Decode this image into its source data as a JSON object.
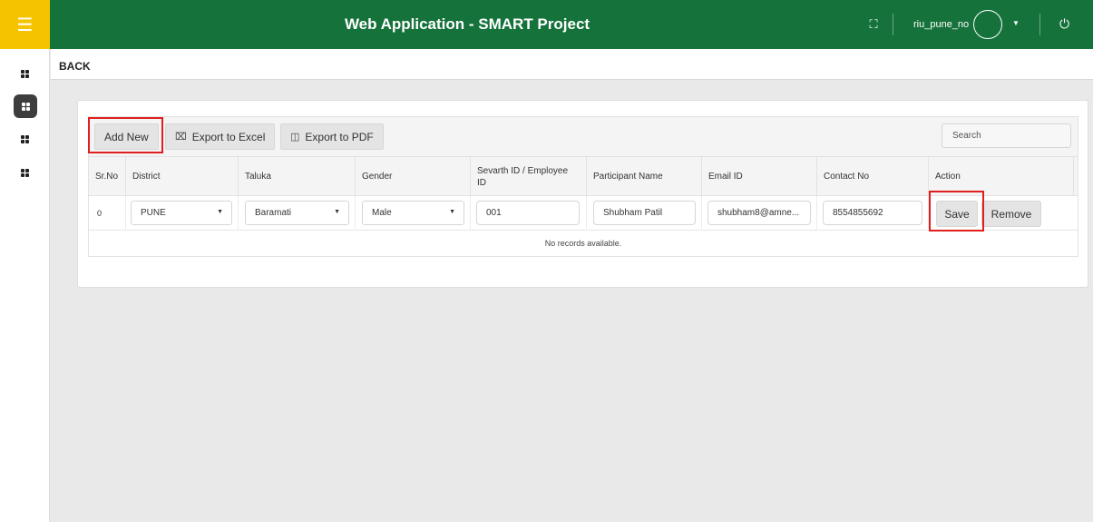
{
  "header": {
    "menu_icon": "hamburger-icon",
    "title": "Web Application - SMART Project",
    "fullscreen_icon": "fullscreen-icon",
    "username": "riu_pune_no",
    "power_icon": "power-icon"
  },
  "sidebar": {
    "items": [
      {
        "icon": "grid-icon",
        "active": false
      },
      {
        "icon": "grid-icon",
        "active": true
      },
      {
        "icon": "grid-icon",
        "active": false
      },
      {
        "icon": "grid-icon",
        "active": false
      }
    ]
  },
  "nav": {
    "back_label": "BACK"
  },
  "toolbar": {
    "add_new_label": "Add New",
    "export_excel_label": "Export to Excel",
    "export_pdf_label": "Export to PDF",
    "search_placeholder": "Search"
  },
  "table": {
    "columns": [
      "Sr.No",
      "District",
      "Taluka",
      "Gender",
      "Sevarth ID / Employee ID",
      "Participant Name",
      "Email ID",
      "Contact No",
      "Action"
    ],
    "edit_row": {
      "sr_no": "0",
      "district": "PUNE",
      "taluka": "Baramati",
      "gender": "Male",
      "sevarth_id": "001",
      "participant_name": "Shubham Patil",
      "email": "shubham8@amne...",
      "contact_no": "8554855692",
      "save_label": "Save",
      "remove_label": "Remove"
    },
    "empty_message": "No records available."
  },
  "colors": {
    "header_green": "#15723b",
    "menu_yellow": "#f5c400",
    "highlight_red": "#e01e1e"
  }
}
